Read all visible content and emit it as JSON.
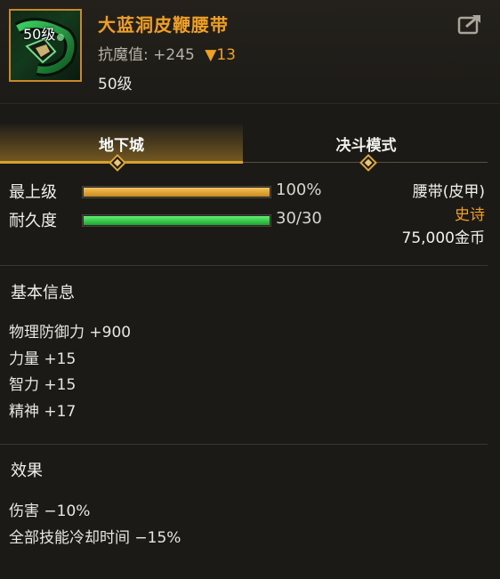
{
  "item": {
    "level_badge": "50级",
    "name": "大蓝洞皮鞭腰带",
    "stat_label": "抗魔值:",
    "stat_value": "+245",
    "stat_delta": "▼13",
    "required_level": "50级"
  },
  "tabs": [
    {
      "label": "地下城",
      "active": true
    },
    {
      "label": "决斗模式",
      "active": false
    }
  ],
  "bars": [
    {
      "label": "最上级",
      "value": "100%",
      "fraction": 1.0,
      "color": "#e0a030"
    },
    {
      "label": "耐久度",
      "value": "30/30",
      "fraction": 1.0,
      "color": "#2ed048"
    }
  ],
  "info": {
    "type": "腰带(皮甲)",
    "rarity": "史诗",
    "price": "75,000金币"
  },
  "basic_info": {
    "title": "基本信息",
    "attrs": [
      "物理防御力 +900",
      "力量 +15",
      "智力 +15",
      "精神 +17"
    ]
  },
  "effects": {
    "title": "效果",
    "attrs": [
      "伤害 −10%",
      "全部技能冷却时间 −15%"
    ]
  },
  "colors": {
    "accent": "#f0a020",
    "background": "#1c1a17"
  },
  "icons": {
    "share": "share-icon",
    "item": "belt-item-icon"
  }
}
